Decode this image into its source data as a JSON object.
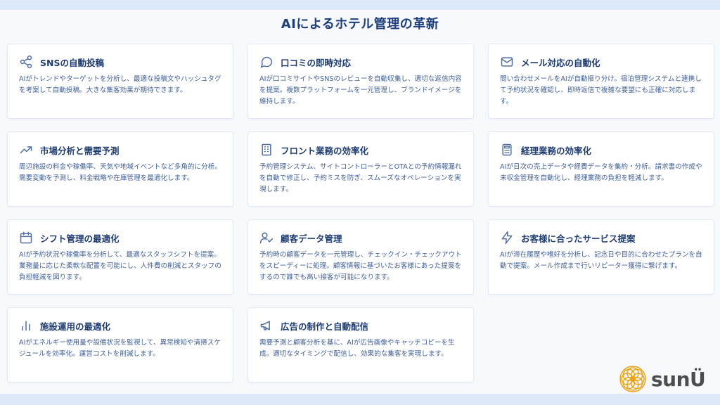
{
  "page": {
    "title": "AIによるホテル管理の革新"
  },
  "colors": {
    "accent": "#1e3f7a",
    "text": "#3f5f93",
    "icon": "#4f6f9f",
    "logo": "#e8a317"
  },
  "cards": [
    {
      "icon": "share-icon",
      "title": "SNSの自動投稿",
      "desc": "AIがトレンドやターゲットを分析し、最適な投稿文やハッシュタグを考案して自動投稿。大きな集客効果が期待できます。"
    },
    {
      "icon": "chat-bubble-icon",
      "title": "口コミの即時対応",
      "desc": "AIが口コミサイトやSNSのレビューを自動収集し、適切な返信内容を提案。複数プラットフォームを一元管理し、ブランドイメージを維持します。"
    },
    {
      "icon": "mail-icon",
      "title": "メール対応の自動化",
      "desc": "問い合わせメールをAIが自動振り分け。宿泊管理システムと連携して予約状況を確認し、即時返信で複雑な要望にも正確に対応します。"
    },
    {
      "icon": "trend-up-icon",
      "title": "市場分析と需要予測",
      "desc": "周辺施設の料金や稼働率、天気や地域イベントなど多角的に分析。需要変動を予測し、料金戦略や在庫管理を最適化します。"
    },
    {
      "icon": "building-icon",
      "title": "フロント業務の効率化",
      "desc": "予約管理システム、サイトコントローラーとOTAとの予約情報漏れを自動で修正し、予約ミスを防ぎ、スムーズなオペレーションを実現します。"
    },
    {
      "icon": "calculator-icon",
      "title": "経理業務の効率化",
      "desc": "AIが日次の売上データや経費データを集約・分析。請求書の作成や未収金管理を自動化し、経理業務の負担を軽減します。"
    },
    {
      "icon": "calendar-icon",
      "title": "シフト管理の最適化",
      "desc": "AIが予約状況や稼働率を分析して、最適なスタッフシフトを提案。業務量に応じた柔軟な配置を可能にし、人件費の削減とスタッフの負担軽減を図ります。"
    },
    {
      "icon": "user-check-icon",
      "title": "顧客データ管理",
      "desc": "予約時の顧客データを一元管理し、チェックイン・チェックアウトをスピーディーに処理。顧客情報に基づいたお客様にあった提案をするので誰でも高い接客が可能になります。"
    },
    {
      "icon": "lightning-icon",
      "title": "お客様に合ったサービス提案",
      "desc": "AIが滞在履歴や嗜好を分析し、記念日や目的に合わせたプランを自動で提案。メール作成まで行いリピーター獲得に繋げます。"
    },
    {
      "icon": "bar-chart-icon",
      "title": "施設運用の最適化",
      "desc": "AIがエネルギー使用量や設備状況を監視して、異常検知や清掃スケジュールを効率化。運営コストを削減します。"
    },
    {
      "icon": "megaphone-icon",
      "title": "広告の制作と自動配信",
      "desc": "需要予測と顧客分析を基に、AIが広告画像やキャッチコピーを生成。適切なタイミングで配信し、効果的な集客を実現します。"
    }
  ],
  "logo": {
    "text": "sunÜ"
  }
}
